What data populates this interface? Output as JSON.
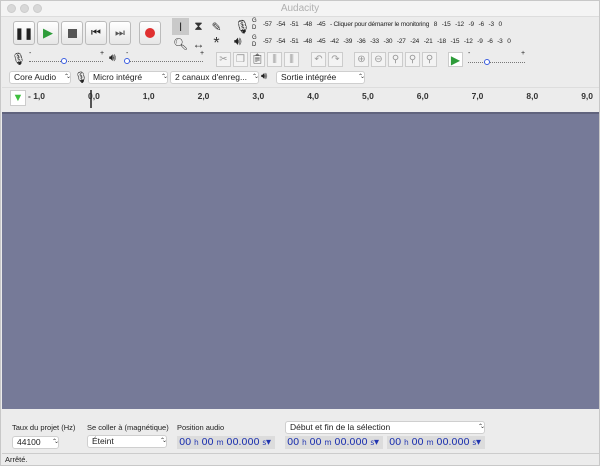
{
  "window": {
    "title": "Audacity"
  },
  "transport": {
    "buttons": [
      "pause",
      "play",
      "stop",
      "skip-start",
      "skip-end",
      "record"
    ]
  },
  "tools": [
    "selection",
    "envelope",
    "draw",
    "zoom",
    "time-shift",
    "multi"
  ],
  "meters": {
    "record_ticks": [
      "-57",
      "-54",
      "-51",
      "-48",
      "-45",
      "- Cliquer pour démarrer le monitoring",
      "8",
      "-15",
      "-12",
      "-9",
      "-6",
      "-3",
      "0"
    ],
    "play_ticks": [
      "-57",
      "-54",
      "-51",
      "-48",
      "-45",
      "-42",
      "-39",
      "-36",
      "-33",
      "-30",
      "-27",
      "-24",
      "-21",
      "-18",
      "-15",
      "-12",
      "-9",
      "-6",
      "-3",
      "0"
    ],
    "channel_labels": [
      "G",
      "D"
    ]
  },
  "mixer": {
    "minus": "-",
    "plus": "+",
    "record_volume": 0.55,
    "play_volume": 0.0,
    "play_speed": 0.35
  },
  "devices": {
    "host": "Core Audio",
    "input": "Micro intégré",
    "channels": "2 canaux d'enreg...",
    "output": "Sortie intégrée"
  },
  "ruler": {
    "labels": [
      "- 1,0",
      "0,0",
      "1,0",
      "2,0",
      "3,0",
      "4,0",
      "5,0",
      "6,0",
      "7,0",
      "8,0",
      "9,0"
    ]
  },
  "colors": {
    "track_bg": "#767a98",
    "time_text": "#2236b0",
    "record": "#e03030",
    "play": "#2e9c3a"
  },
  "bottom": {
    "rate_label": "Taux du projet (Hz)",
    "rate_value": "44100",
    "snap_label": "Se coller à (magnétique)",
    "snap_value": "Éteint",
    "position_label": "Position audio",
    "selection_mode": "Début et fin de la sélection",
    "time_hh": "00",
    "time_h": "h",
    "time_mm": "00",
    "time_m": "m",
    "time_ss": "00.000",
    "time_s": "s"
  },
  "status": "Arrêté."
}
